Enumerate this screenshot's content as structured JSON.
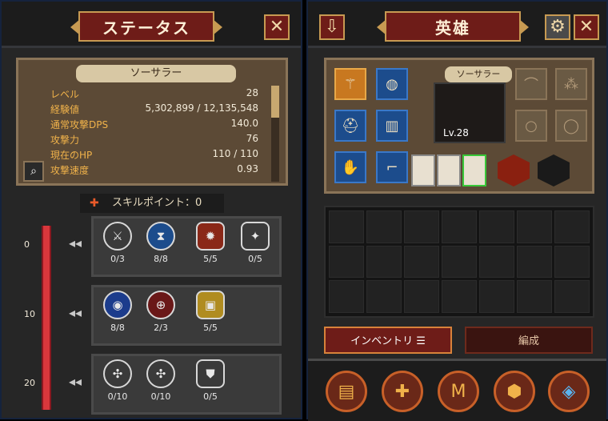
{
  "status_panel": {
    "title": "ステータス",
    "close": "✕",
    "character_name": "ソーサラー",
    "stats": [
      {
        "label": "レベル",
        "value": "28"
      },
      {
        "label": "経験値",
        "value": "5,302,899 / 12,135,548"
      },
      {
        "label": "通常攻撃DPS",
        "value": "140.0"
      },
      {
        "label": "攻撃力",
        "value": "76"
      },
      {
        "label": "現在のHP",
        "value": "110 / 110"
      },
      {
        "label": "攻撃速度",
        "value": "0.93"
      }
    ],
    "search_icon": "magnifier-icon",
    "skill_points_label": "スキルポイント：0",
    "tier_labels": [
      "0",
      "10",
      "20"
    ],
    "tiers": [
      {
        "skills": [
          {
            "icon": "sword-icon",
            "level": "0/3"
          },
          {
            "icon": "hourglass-icon",
            "level": "8/8"
          },
          {
            "icon": "fire-icon",
            "level": "5/5"
          },
          {
            "icon": "blade-icon",
            "level": "0/5"
          }
        ]
      },
      {
        "skills": [
          {
            "icon": "orb-icon",
            "level": "8/8"
          },
          {
            "icon": "target-icon",
            "level": "2/3"
          },
          {
            "icon": "gold-icon",
            "level": "5/5"
          }
        ]
      },
      {
        "skills": [
          {
            "icon": "rune-icon",
            "level": "0/10"
          },
          {
            "icon": "rune-icon",
            "level": "0/10"
          },
          {
            "icon": "helmet-icon",
            "level": "0/5"
          }
        ]
      }
    ]
  },
  "hero_panel": {
    "title": "英雄",
    "close": "✕",
    "character_name": "ソーサラー",
    "level": "Lv.28",
    "tabs": [
      "インベントリ",
      "編成"
    ],
    "colors": {
      "accent": "#6e1c18",
      "gold": "#c79a52",
      "equip_slot": "#1c4c8c"
    }
  }
}
